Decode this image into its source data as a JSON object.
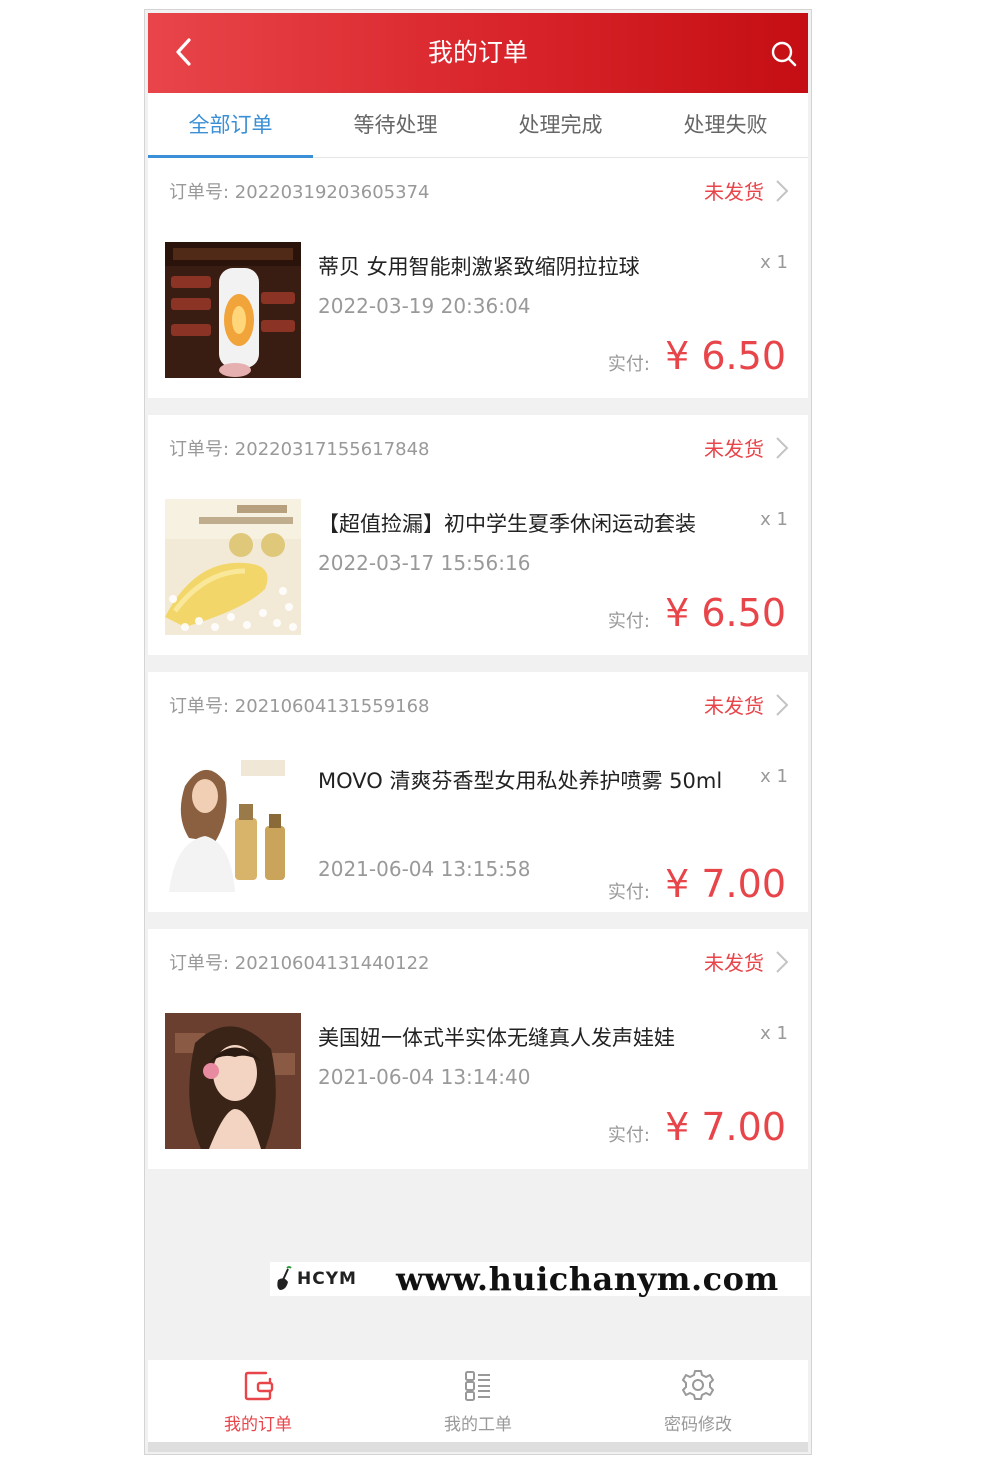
{
  "header": {
    "title": "我的订单",
    "back_icon": "chevron-left-icon",
    "search_icon": "search-icon"
  },
  "tabs": [
    {
      "label": "全部订单",
      "active": true
    },
    {
      "label": "等待处理",
      "active": false
    },
    {
      "label": "处理完成",
      "active": false
    },
    {
      "label": "处理失败",
      "active": false
    }
  ],
  "orders": [
    {
      "order_no": "订单号: 20220319203605374",
      "status": "未发货",
      "product": "蒂贝 女用智能刺激紧致缩阴拉拉球",
      "qty": "x 1",
      "date": "2022-03-19 20:36:04",
      "paid_label": "实付:",
      "price": "¥ 6.50"
    },
    {
      "order_no": "订单号: 20220317155617848",
      "status": "未发货",
      "product": "【超值捡漏】初中学生夏季休闲运动套装",
      "qty": "x 1",
      "date": "2022-03-17 15:56:16",
      "paid_label": "实付:",
      "price": "¥ 6.50"
    },
    {
      "order_no": "订单号: 20210604131559168",
      "status": "未发货",
      "product": "MOVO 清爽芬香型女用私处养护喷雾 50ml",
      "qty": "x 1",
      "date": "2021-06-04 13:15:58",
      "paid_label": "实付:",
      "price": "¥ 7.00"
    },
    {
      "order_no": "订单号: 20210604131440122",
      "status": "未发货",
      "product": "美国妞一体式半实体无缝真人发声娃娃",
      "qty": "x 1",
      "date": "2021-06-04 13:14:40",
      "paid_label": "实付:",
      "price": "¥ 7.00"
    }
  ],
  "watermark": {
    "logo": "HCYM",
    "url": "www.huichanym.com"
  },
  "tabbar": [
    {
      "label": "我的订单",
      "icon": "wallet-icon",
      "active": true
    },
    {
      "label": "我的工单",
      "icon": "list-icon",
      "active": false
    },
    {
      "label": "密码修改",
      "icon": "gear-icon",
      "active": false
    }
  ],
  "colors": {
    "accent": "#e8454a",
    "tab_active": "#3b8fd6",
    "muted": "#999999"
  }
}
